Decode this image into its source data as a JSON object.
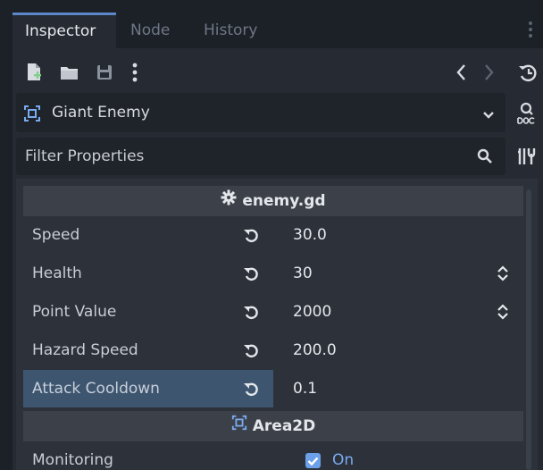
{
  "tabs": [
    {
      "label": "Inspector",
      "active": true
    },
    {
      "label": "Node",
      "active": false
    },
    {
      "label": "History",
      "active": false
    }
  ],
  "object_selector": {
    "label": "Giant Enemy",
    "icon": "area2d-node-icon"
  },
  "filter": {
    "placeholder": "Filter Properties"
  },
  "sections": {
    "script": {
      "label": "enemy.gd",
      "icon": "gear-icon"
    },
    "area2d": {
      "label": "Area2D",
      "icon": "area2d-node-icon"
    }
  },
  "properties": [
    {
      "name": "Speed",
      "value": "30.0",
      "has_spinner": false,
      "highlighted": false
    },
    {
      "name": "Health",
      "value": "30",
      "has_spinner": true,
      "highlighted": false
    },
    {
      "name": "Point Value",
      "value": "2000",
      "has_spinner": true,
      "highlighted": false
    },
    {
      "name": "Hazard Speed",
      "value": "200.0",
      "has_spinner": false,
      "highlighted": false
    },
    {
      "name": "Attack Cooldown",
      "value": "0.1",
      "has_spinner": false,
      "highlighted": true
    }
  ],
  "monitoring": {
    "name": "Monitoring",
    "checked": true,
    "label": "On"
  },
  "colors": {
    "accent": "#5b86c8",
    "highlight": "#3e5570",
    "checkbox": "#6ca0e8"
  }
}
